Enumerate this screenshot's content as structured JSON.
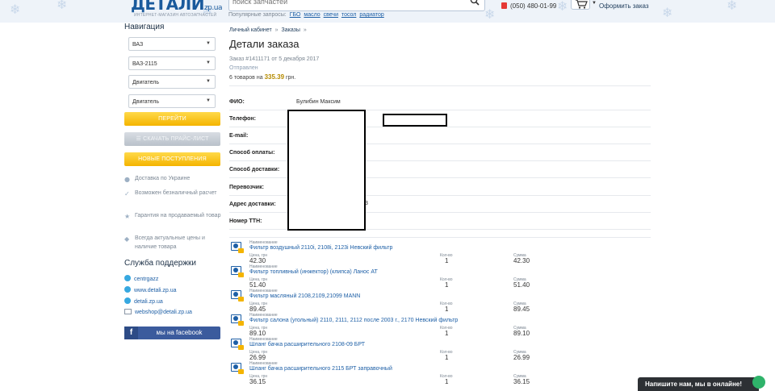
{
  "header": {
    "logo_text": "ДЕТАЛИ",
    "logo_domain": "zp.ua",
    "tagline": "интернет-магазин автозапчастей",
    "search_placeholder": "поиск запчастей",
    "popular_label": "Популярные запросы:",
    "popular_queries": [
      "ГБО",
      "масло",
      "свечи",
      "тосол",
      "радиатор"
    ],
    "phone": "(050) 480-01-99",
    "checkout_label": "Оформить заказ"
  },
  "sidebar": {
    "nav_title": "Навигация",
    "selects": [
      "ВАЗ",
      "ВАЗ-2115",
      "Двигатель",
      "Двигатель"
    ],
    "go_button": "ПЕРЕЙТИ",
    "price_button": "СКАЧАТЬ ПРАЙС-ЛИСТ",
    "new_button": "НОВЫЕ ПОСТУПЛЕНИЯ",
    "features": [
      {
        "icon": "user-icon",
        "text": "Доставка по Украине"
      },
      {
        "icon": "check-icon",
        "text": "Возможен безналичный расчет"
      },
      {
        "icon": "star-icon",
        "text": "Гарантия на продаваемый товар"
      },
      {
        "icon": "tag-icon",
        "text": "Всегда актуальные цены и наличие товара"
      }
    ],
    "support_title": "Служба поддержки",
    "support": [
      {
        "type": "skype",
        "text": "centrgazz"
      },
      {
        "type": "skype",
        "text": "www.detali.zp.ua"
      },
      {
        "type": "skype",
        "text": "detali.zp.ua"
      },
      {
        "type": "email",
        "text": "webshop@detali.zp.ua"
      }
    ],
    "facebook_letter": "f",
    "facebook_label": "мы на facebook"
  },
  "main": {
    "breadcrumbs": [
      "Личный кабинет",
      "Заказы"
    ],
    "breadcrumb_sep": "»",
    "title": "Детали заказа",
    "order_meta": "Заказ #1411171 от 5 декабря 2017",
    "status": "Отправлен",
    "total_prefix": "6 товаров на",
    "total_value": "335.39",
    "total_currency": "грн.",
    "info": [
      {
        "label": "ФИО:",
        "value": "Булибин Максим"
      },
      {
        "label": "Телефон:",
        "value": ""
      },
      {
        "label": "E-mail:",
        "value": ""
      },
      {
        "label": "Способ оплаты:",
        "value": ""
      },
      {
        "label": "Способ доставки:",
        "value": ""
      },
      {
        "label": "Перевозчик:",
        "value": ""
      },
      {
        "label": "Адрес доставки:",
        "value": ""
      },
      {
        "label": "Номер ТТН:",
        "value": ""
      }
    ],
    "stray_char": "3",
    "item_captions": {
      "name": "Наименование",
      "price": "Цена, грн",
      "qty": "Кол-во",
      "sum": "Сумма"
    },
    "items": [
      {
        "name": "Фильтр воздушный 2110i, 2108i, 2123i Невский фильтр",
        "price": "42.30",
        "qty": "1",
        "sum": "42.30"
      },
      {
        "name": "Фильтр топливный (инжектор) (клипса) Ланос АТ",
        "price": "51.40",
        "qty": "1",
        "sum": "51.40"
      },
      {
        "name": "Фильтр масляный 2108,2109,21099 MANN",
        "price": "89.45",
        "qty": "1",
        "sum": "89.45"
      },
      {
        "name": "Фильтр салона (угольный) 2110, 2111, 2112 после 2003 г., 2170 Невский фильтр",
        "price": "89.10",
        "qty": "1",
        "sum": "89.10"
      },
      {
        "name": "Шланг бачка расширительного 2108-09 БРТ",
        "price": "26.99",
        "qty": "1",
        "sum": "26.99"
      },
      {
        "name": "Шланг бачка расширительного 2115 БРТ заправочный",
        "price": "36.15",
        "qty": "1",
        "sum": "36.15"
      }
    ]
  },
  "chat": {
    "label": "Напишите нам, мы в онлайне!"
  },
  "colors": {
    "accent": "#1d5fa6",
    "button_yellow": "#f4b400",
    "facebook": "#3b5b9d",
    "chat_bg": "#2d3034",
    "chat_dot": "#2fb36a"
  }
}
